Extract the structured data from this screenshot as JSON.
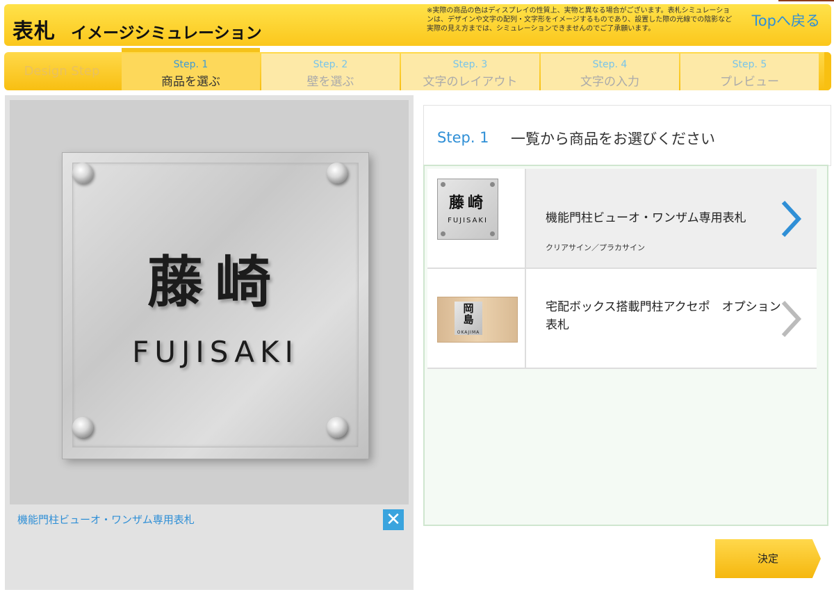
{
  "header": {
    "title": "表札",
    "subtitle": "イメージシミュレーション",
    "notice": "※実際の商品の色はディスプレイの性質上、実物と異なる場合がございます。表札シミュレーションは、デザインや文字の配列・文字形をイメージするものであり、設置した際の光線での陰影など実際の見え方までは、シミュレーションできませんのでご了承願います。",
    "top_link": "Topへ戻る",
    "accent_color": "#fbc71c"
  },
  "steps": {
    "design_label": "Design Step",
    "items": [
      {
        "num": "Step. 1",
        "label": "商品を選ぶ"
      },
      {
        "num": "Step. 2",
        "label": "壁を選ぶ"
      },
      {
        "num": "Step. 3",
        "label": "文字のレイアウト"
      },
      {
        "num": "Step. 4",
        "label": "文字の入力"
      },
      {
        "num": "Step. 5",
        "label": "プレビュー"
      }
    ]
  },
  "preview": {
    "kanji": "藤崎",
    "roman": "FUJISAKI",
    "caption": "機能門柱ビューオ・ワンザム専用表札",
    "close_icon": "close-icon"
  },
  "main": {
    "step_num": "Step. 1",
    "step_text": "一覧から商品をお選びください",
    "products": [
      {
        "name": "機能門柱ビューオ・ワンザム専用表札",
        "sub": "クリアサイン／プラカサイン",
        "thumb_kanji": "藤崎",
        "thumb_roman": "FUJISAKI"
      },
      {
        "name": "宅配ボックス搭載門柱アクセポ　オプション表札",
        "thumb_kanji_1": "岡",
        "thumb_kanji_2": "島",
        "thumb_roman": "OKAJIMA"
      }
    ],
    "decide_label": "決定"
  }
}
